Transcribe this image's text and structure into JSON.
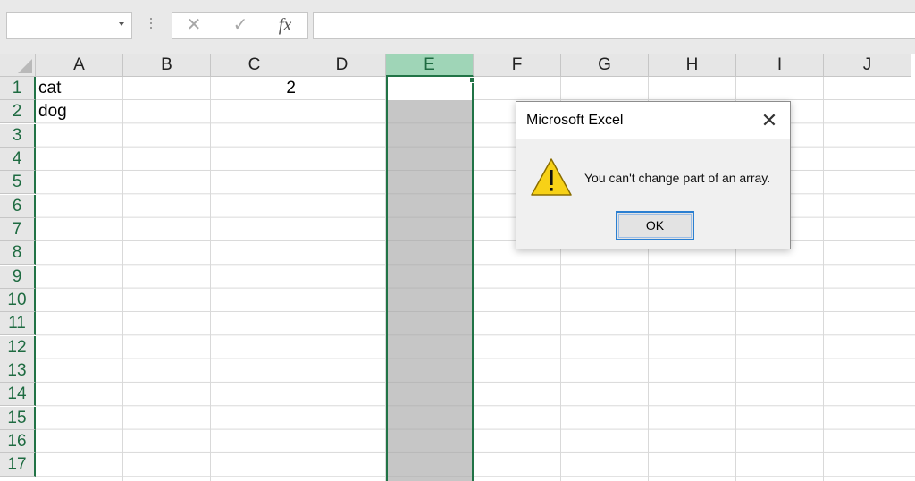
{
  "formula_bar": {
    "name_box_value": "",
    "cancel_symbol": "✕",
    "enter_symbol": "✓",
    "function_symbol": "fx",
    "formula_value": ""
  },
  "sheet": {
    "columns": [
      "A",
      "B",
      "C",
      "D",
      "E",
      "F",
      "G",
      "H",
      "I",
      "J"
    ],
    "selected_column": "E",
    "rows": [
      "1",
      "2",
      "3",
      "4",
      "5",
      "6",
      "7",
      "8",
      "9",
      "10",
      "11",
      "12",
      "13",
      "14",
      "15",
      "16",
      "17"
    ],
    "cells": {
      "A1": "cat",
      "A2": "dog",
      "C1": "2"
    }
  },
  "dialog": {
    "title": "Microsoft Excel",
    "close_symbol": "✕",
    "icon": "warning-icon",
    "message": "You can't change part of an array.",
    "ok_label": "OK"
  },
  "colors": {
    "excel_green": "#217346",
    "selected_header": "#9fd5b7",
    "selection_fill": "#c6c6c6",
    "warning_yellow": "#f7d117"
  }
}
